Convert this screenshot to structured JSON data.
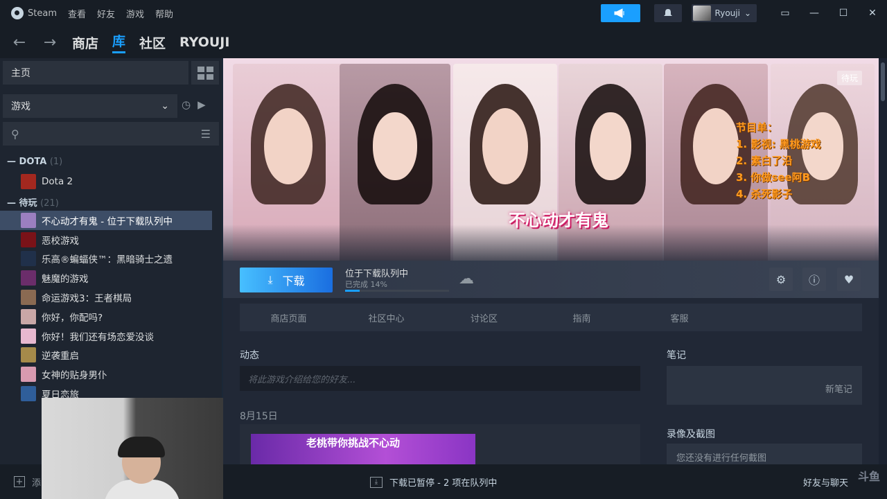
{
  "titlebar": {
    "menu": [
      "Steam",
      "查看",
      "好友",
      "游戏",
      "帮助"
    ],
    "username": "Ryouji"
  },
  "nav": {
    "links": [
      "商店",
      "库",
      "社区",
      "RYOUJI"
    ],
    "active": "库"
  },
  "sidebar": {
    "home_label": "主页",
    "filter_label": "游戏",
    "sections": [
      {
        "name": "DOTA",
        "count": "(1)",
        "items": [
          "Dota 2"
        ]
      },
      {
        "name": "待玩",
        "count": "(21)",
        "items": [
          "不心动才有鬼 - 位于下载队列中",
          "恶校游戏",
          "乐高®蝙蝠侠™：黑暗骑士之遗",
          "魅魔的游戏",
          "命运游戏3：王者棋局",
          "你好，你配吗?",
          "你好！我们还有场恋爱没谈",
          "逆袭重启",
          "女神的贴身男仆",
          "夏日恋旅"
        ]
      }
    ],
    "footer_label": "添"
  },
  "hero": {
    "game_title": "不心动才有鬼",
    "tag": "待玩",
    "program_lines": [
      "节目单：",
      "1. 影视: 黑桃游戏",
      "2. 素白了沿",
      "3. 你做see阿B",
      "4. 杀死影子"
    ]
  },
  "actions": {
    "download_label": "下载",
    "status": "位于下载队列中",
    "progress_text": "已完成 14%",
    "progress": 0.14
  },
  "tabs": [
    "商店页面",
    "社区中心",
    "讨论区",
    "指南",
    "客服"
  ],
  "activity": {
    "title": "动态",
    "placeholder": "将此游戏介绍给您的好友...",
    "date": "8月15日",
    "news_image_text": "老桃带你挑战不心动"
  },
  "notes": {
    "title": "笔记",
    "new_note": "新笔记"
  },
  "screenshots": {
    "title": "录像及截图",
    "empty": "您还没有进行任何截图"
  },
  "bottom": {
    "download_status": "下载已暂停 - 2 项在队列中",
    "friends": "好友与聊天"
  },
  "colors": {
    "accent": "#1a9fff",
    "background": "#1b2838",
    "program_orange": "#ff9a1f"
  }
}
